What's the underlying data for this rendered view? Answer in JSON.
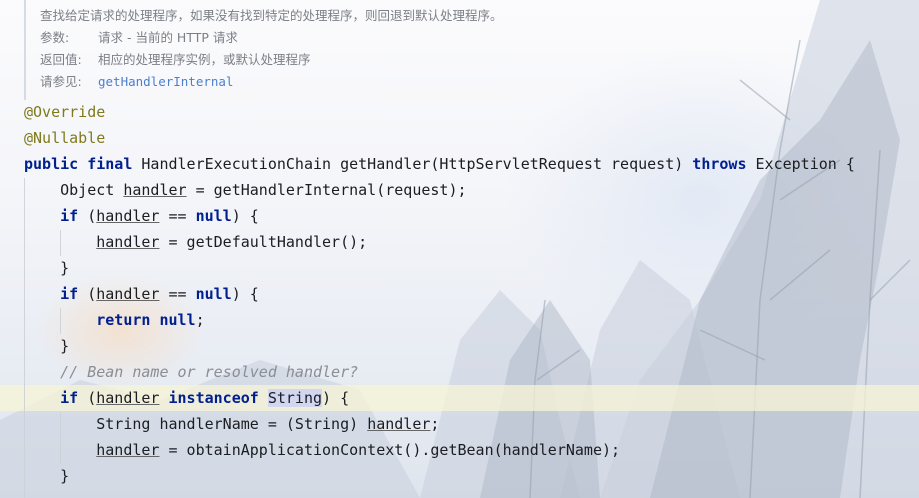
{
  "javadoc": {
    "description": "查找给定请求的处理程序，如果没有找到特定的处理程序，则回退到默认处理程序。",
    "param_key": "参数:",
    "param_value": "请求 - 当前的 HTTP 请求",
    "return_key": "返回值:",
    "return_value": "相应的处理程序实例，或默认处理程序",
    "see_key": "请参见:",
    "see_link": "getHandlerInternal"
  },
  "code": {
    "l1": "@Override",
    "l2": "@Nullable",
    "l3_kw1": "public",
    "l3_kw2": "final",
    "l3_sig": " HandlerExecutionChain getHandler(HttpServletRequest request) ",
    "l3_throws": "throws",
    "l3_end": " Exception {",
    "l4_a": "    Object ",
    "l4_var": "handler",
    "l4_b": " = getHandlerInternal(request);",
    "l5_kw": "if",
    "l5_a": " (",
    "l5_var": "handler",
    "l5_b": " == ",
    "l5_null": "null",
    "l5_c": ") {",
    "l6_var": "handler",
    "l6_b": " = getDefaultHandler();",
    "l7": "    }",
    "l8_kw": "if",
    "l8_a": " (",
    "l8_var": "handler",
    "l8_b": " == ",
    "l8_null": "null",
    "l8_c": ") {",
    "l9_kw": "return",
    "l9_null": "null",
    "l9_c": ";",
    "l10": "    }",
    "l11": "// Bean name or resolved handler?",
    "l12_kw": "if",
    "l12_a": " (",
    "l12_var": "handler",
    "l12_kw2": "instanceof",
    "l12_type": "String",
    "l12_c": ") {",
    "l13_a": "String handlerName = (String) ",
    "l13_var": "handler",
    "l13_c": ";",
    "l14_var": "handler",
    "l14_b": " = obtainApplicationContext().getBean(handlerName);",
    "l15": "    }"
  }
}
